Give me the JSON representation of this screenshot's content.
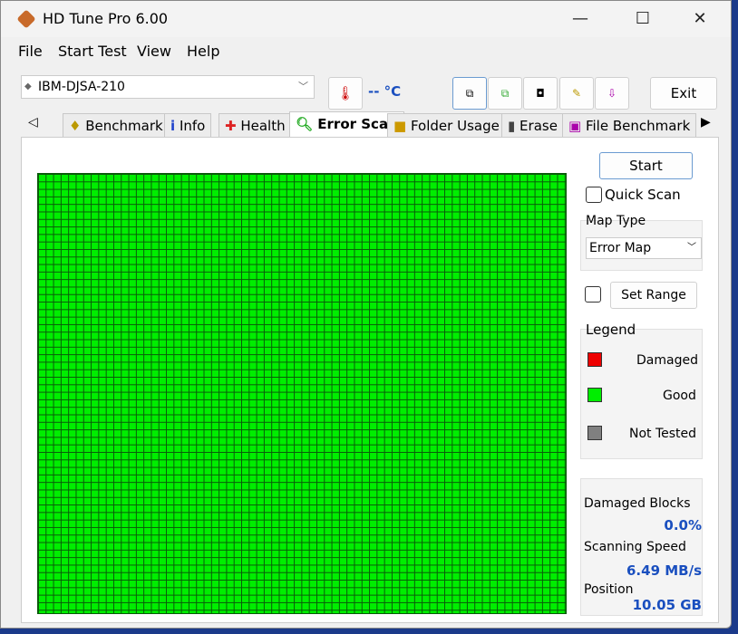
{
  "window": {
    "title": "HD Tune Pro 6.00",
    "minimize": "—",
    "maximize": "☐",
    "close": "✕"
  },
  "menu": [
    "File",
    "Start Test",
    "View",
    "Help"
  ],
  "toolbar": {
    "drive": "IBM-DJSA-210",
    "temperature": "-- °C",
    "exit": "Exit"
  },
  "tabs": [
    "Benchmark",
    "Info",
    "Health",
    "Error Scan",
    "Folder Usage",
    "Erase",
    "File Benchmark"
  ],
  "active_tab": "Error Scan",
  "side": {
    "start": "Start",
    "quick_scan": "Quick Scan",
    "map_type_label": "Map Type",
    "map_type": "Error Map",
    "set_range": "Set Range",
    "legend_title": "Legend",
    "legend": [
      {
        "label": "Damaged",
        "color": "#ee0000"
      },
      {
        "label": "Good",
        "color": "#00ee00"
      },
      {
        "label": "Not Tested",
        "color": "#808080"
      }
    ]
  },
  "stats": {
    "damaged_label": "Damaged Blocks",
    "damaged": "0.0%",
    "speed_label": "Scanning Speed",
    "speed": "6.49 MB/s",
    "position_label": "Position",
    "position": "10.05 GB"
  },
  "scan_progress_percent": 100
}
